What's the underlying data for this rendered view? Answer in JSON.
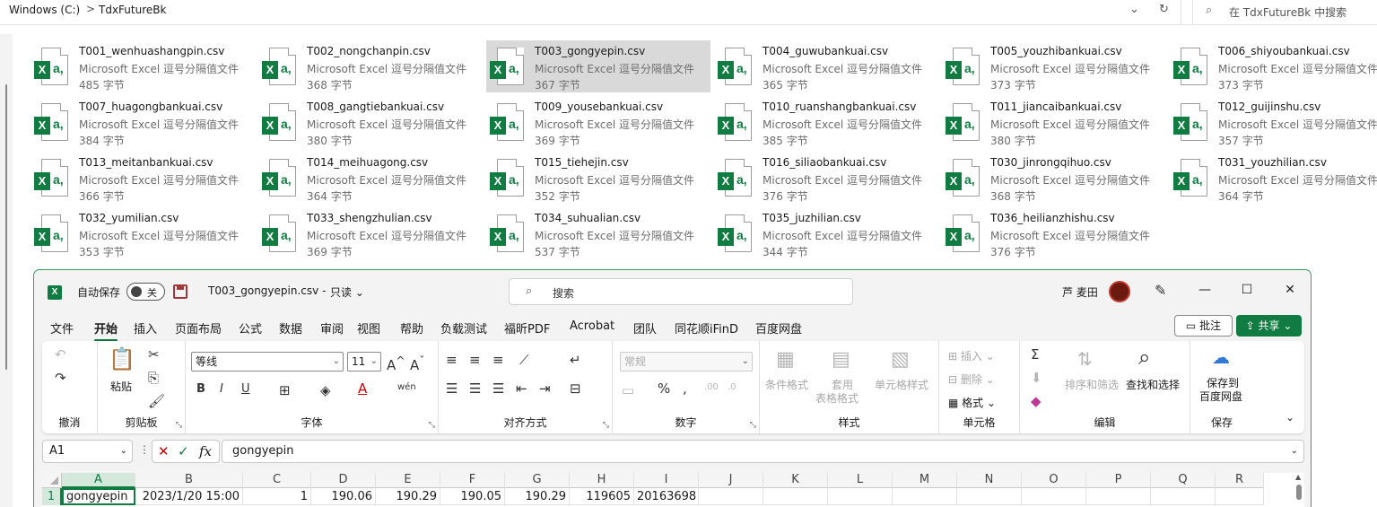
{
  "explorer": {
    "breadcrumb": [
      "Windows (C:)",
      "TdxFutureBk"
    ],
    "crumb_sep": ">",
    "search_placeholder": "在 TdxFutureBk 中搜索",
    "files": [
      {
        "name": "T001_wenhuashangpin.csv",
        "type": "Microsoft Excel 逗号分隔值文件",
        "size": "485 字节"
      },
      {
        "name": "T002_nongchanpin.csv",
        "type": "Microsoft Excel 逗号分隔值文件",
        "size": "368 字节"
      },
      {
        "name": "T003_gongyepin.csv",
        "type": "Microsoft Excel 逗号分隔值文件",
        "size": "367 字节",
        "selected": true
      },
      {
        "name": "T004_guwubankuai.csv",
        "type": "Microsoft Excel 逗号分隔值文件",
        "size": "365 字节"
      },
      {
        "name": "T005_youzhibankuai.csv",
        "type": "Microsoft Excel 逗号分隔值文件",
        "size": "373 字节"
      },
      {
        "name": "T006_shiyoubankuai.csv",
        "type": "Microsoft Excel 逗号分隔值文件",
        "size": "373 字节"
      },
      {
        "name": "T007_huagongbankuai.csv",
        "type": "Microsoft Excel 逗号分隔值文件",
        "size": "384 字节"
      },
      {
        "name": "T008_gangtiebankuai.csv",
        "type": "Microsoft Excel 逗号分隔值文件",
        "size": "380 字节"
      },
      {
        "name": "T009_yousebankuai.csv",
        "type": "Microsoft Excel 逗号分隔值文件",
        "size": "369 字节"
      },
      {
        "name": "T010_ruanshangbankuai.csv",
        "type": "Microsoft Excel 逗号分隔值文件",
        "size": "385 字节"
      },
      {
        "name": "T011_jiancaibankuai.csv",
        "type": "Microsoft Excel 逗号分隔值文件",
        "size": "380 字节"
      },
      {
        "name": "T012_guijinshu.csv",
        "type": "Microsoft Excel 逗号分隔值文件",
        "size": "357 字节"
      },
      {
        "name": "T013_meitanbankuai.csv",
        "type": "Microsoft Excel 逗号分隔值文件",
        "size": "366 字节"
      },
      {
        "name": "T014_meihuagong.csv",
        "type": "Microsoft Excel 逗号分隔值文件",
        "size": "364 字节"
      },
      {
        "name": "T015_tiehejin.csv",
        "type": "Microsoft Excel 逗号分隔值文件",
        "size": "352 字节"
      },
      {
        "name": "T016_siliaobankuai.csv",
        "type": "Microsoft Excel 逗号分隔值文件",
        "size": "376 字节"
      },
      {
        "name": "T030_jinrongqihuo.csv",
        "type": "Microsoft Excel 逗号分隔值文件",
        "size": "368 字节"
      },
      {
        "name": "T031_youzhilian.csv",
        "type": "Microsoft Excel 逗号分隔值文件",
        "size": "364 字节"
      },
      {
        "name": "T032_yumilian.csv",
        "type": "Microsoft Excel 逗号分隔值文件",
        "size": "353 字节"
      },
      {
        "name": "T033_shengzhulian.csv",
        "type": "Microsoft Excel 逗号分隔值文件",
        "size": "369 字节"
      },
      {
        "name": "T034_suhualian.csv",
        "type": "Microsoft Excel 逗号分隔值文件",
        "size": "537 字节"
      },
      {
        "name": "T035_juzhilian.csv",
        "type": "Microsoft Excel 逗号分隔值文件",
        "size": "344 字节"
      },
      {
        "name": "T036_heilianzhishu.csv",
        "type": "Microsoft Excel 逗号分隔值文件",
        "size": "376 字节"
      }
    ]
  },
  "excel": {
    "autosave_label": "自动保存",
    "autosave_state": "关",
    "doc_title": "T003_gongyepin.csv",
    "title_sep": "-",
    "readonly_label": "只读",
    "search_placeholder": "搜索",
    "user_name": "芦 麦田",
    "menu_tabs": [
      "文件",
      "开始",
      "插入",
      "页面布局",
      "公式",
      "数据",
      "审阅",
      "视图",
      "帮助",
      "负载测试",
      "福昕PDF",
      "Acrobat",
      "团队",
      "同花顺iFinD",
      "百度网盘"
    ],
    "active_tab": "开始",
    "comment_label": "批注",
    "share_label": "共享",
    "ribbon": {
      "undo_group": "撤消",
      "clipboard_group": "剪贴板",
      "paste_label": "粘贴",
      "font_group": "字体",
      "font_name": "等线",
      "font_size": "11",
      "align_group": "对齐方式",
      "number_group": "数字",
      "number_format": "常规",
      "styles_group": "样式",
      "cond_format": "条件格式",
      "table_format_1": "套用",
      "table_format_2": "表格格式",
      "cell_styles": "单元格样式",
      "cells_group": "单元格",
      "insert_label": "插入",
      "delete_label": "删除",
      "format_label": "格式",
      "edit_group": "编辑",
      "sort_filter": "排序和筛选",
      "find_select": "查找和选择",
      "save_group": "保存",
      "save_to_1": "保存到",
      "save_to_2": "百度网盘"
    },
    "name_box": "A1",
    "fx_label": "fx",
    "formula_value": "gongyepin",
    "columns": [
      "A",
      "B",
      "C",
      "D",
      "E",
      "F",
      "G",
      "H",
      "I",
      "J",
      "K",
      "L",
      "M",
      "N",
      "O",
      "P",
      "Q",
      "R"
    ],
    "row_number": "1",
    "row1": [
      "gongyepin",
      "2023/1/20 15:00",
      "1",
      "190.06",
      "190.29",
      "190.05",
      "190.29",
      "119605",
      "20163698",
      "",
      "",
      "",
      "",
      "",
      "",
      "",
      "",
      ""
    ]
  },
  "colors": {
    "excel_green": "#107c41",
    "selection_bg": "#d9d9d9",
    "header_sel_bg": "#d4e8dc"
  }
}
